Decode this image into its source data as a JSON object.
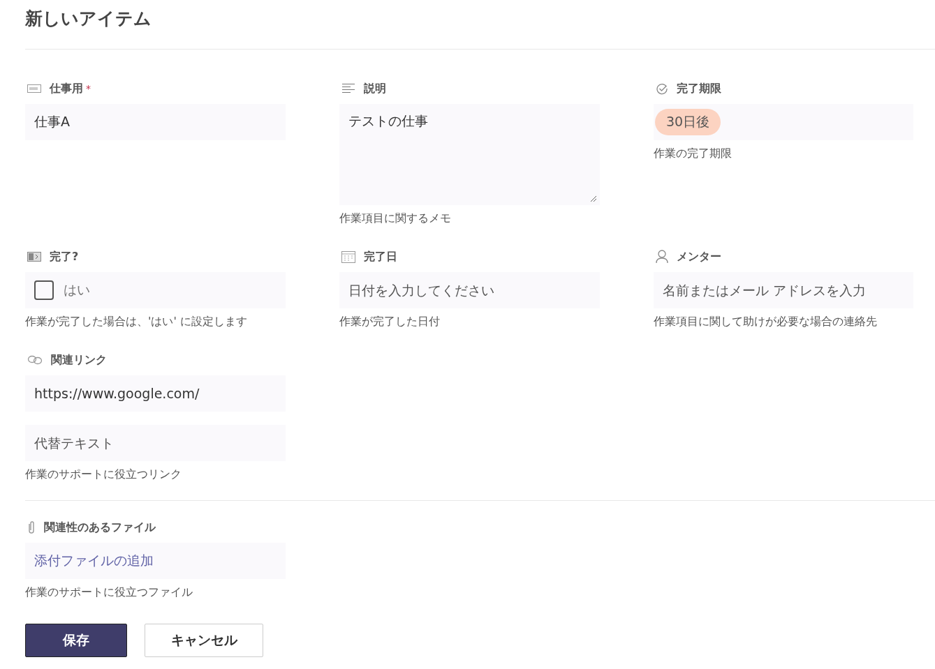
{
  "title": "新しいアイテム",
  "fields": [
    {
      "kind": "text",
      "label": "仕事用",
      "required_mark": "*",
      "value": "仕事A"
    },
    {
      "kind": "multiline",
      "label": "説明",
      "value": "テストの仕事",
      "helper": "作業項目に関するメモ"
    },
    {
      "kind": "tag",
      "label": "完了期限",
      "tag": "30日後",
      "helper": "作業の完了期限"
    },
    {
      "kind": "checkbox",
      "label": "完了?",
      "option": "はい",
      "checked": false,
      "helper": "作業が完了した場合は、'はい' に設定します"
    },
    {
      "kind": "date",
      "label": "完了日",
      "placeholder": "日付を入力してください",
      "helper": "作業が完了した日付"
    },
    {
      "kind": "person",
      "label": "メンター",
      "placeholder": "名前またはメール アドレスを入力",
      "helper": "作業項目に関して助けが必要な場合の連絡先"
    },
    {
      "kind": "link",
      "label": "関連リンク",
      "value": "https://www.google.com/",
      "alt_placeholder": "代替テキスト",
      "helper": "作業のサポートに役立つリンク"
    }
  ],
  "files": {
    "label": "関連性のあるファイル",
    "link": "添付ファイルの追加",
    "helper": "作業のサポートに役立つファイル"
  },
  "buttons": [
    {
      "kind": "primary",
      "label": "保存"
    },
    {
      "kind": "secondary",
      "label": "キャンセル"
    }
  ]
}
